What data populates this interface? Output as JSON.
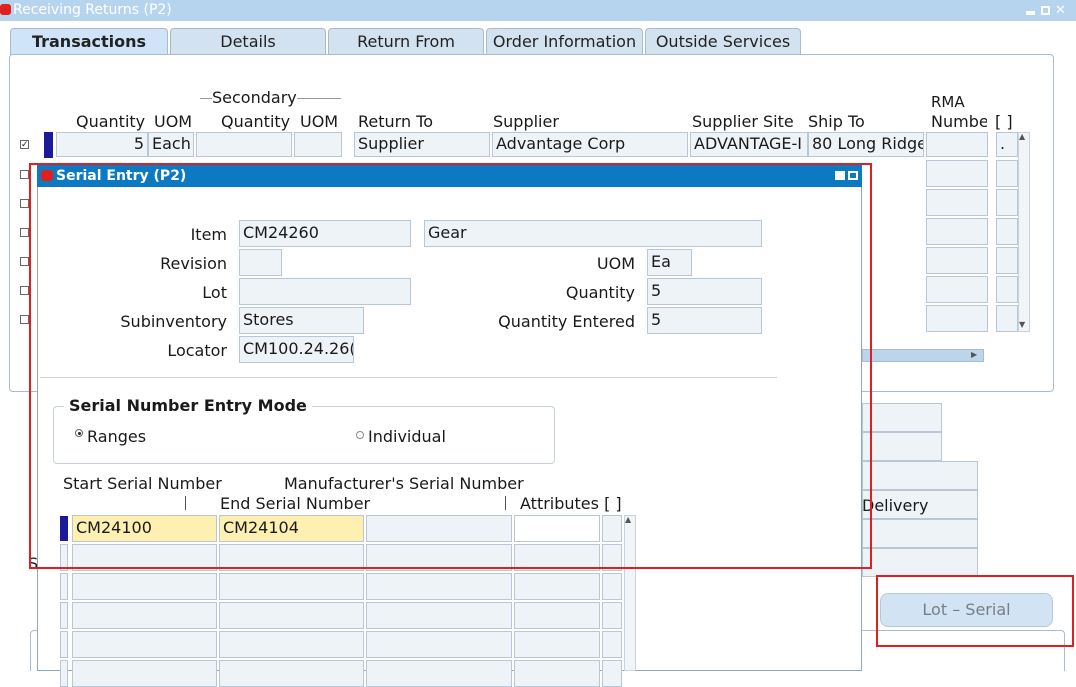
{
  "main_window": {
    "title": "Receiving Returns (P2)",
    "tabs": [
      {
        "label": "Transactions",
        "active": true
      },
      {
        "label": "Details"
      },
      {
        "label": "Return From"
      },
      {
        "label": "Order Information"
      },
      {
        "label": "Outside Services"
      }
    ],
    "columns": {
      "quantity": "Quantity",
      "uom": "UOM",
      "secondary_group": "Secondary",
      "secondary_quantity": "Quantity",
      "secondary_uom": "UOM",
      "return_to": "Return To",
      "supplier": "Supplier",
      "supplier_site": "Supplier Site",
      "ship_to": "Ship To",
      "rma_line1": "RMA",
      "rma_line2": "Numbe",
      "flex": "[ ]"
    },
    "row": {
      "quantity": "5",
      "uom": "Each",
      "return_to": "Supplier",
      "supplier": "Advantage Corp",
      "supplier_site": "ADVANTAGE-I",
      "ship_to": "80 Long Ridge",
      "flex_value": "."
    },
    "partial_delivery_label": "Delivery",
    "left_partial_label": "S",
    "lot_serial_button": "Lot – Serial"
  },
  "serial_dialog": {
    "title": "Serial Entry (P2)",
    "item_label": "Item",
    "item_value": "CM24260",
    "item_description": "Gear",
    "revision_label": "Revision",
    "revision_value": "",
    "lot_label": "Lot",
    "lot_value": "",
    "subinventory_label": "Subinventory",
    "subinventory_value": "Stores",
    "locator_label": "Locator",
    "locator_value": "CM100.24.26(",
    "uom_label": "UOM",
    "uom_value": "Ea",
    "quantity_label": "Quantity",
    "quantity_value": "5",
    "quantity_entered_label": "Quantity Entered",
    "quantity_entered_value": "5",
    "entry_mode_title": "Serial Number Entry Mode",
    "ranges_label": "Ranges",
    "individual_label": "Individual",
    "selected_mode": "Ranges",
    "start_serial_header": "Start Serial Number",
    "manufacturer_serial_header": "Manufacturer's Serial Number",
    "end_serial_header": "End Serial Number",
    "attributes_header": "Attributes [ ]",
    "rows": [
      {
        "start": "CM24100",
        "end": "CM24104"
      }
    ]
  },
  "colors": {
    "title_bar": "#b7d4ee",
    "dialog_title_bar": "#0b7ac2",
    "highlight_box": "#e02020",
    "current_field": "#fdf0b0"
  }
}
